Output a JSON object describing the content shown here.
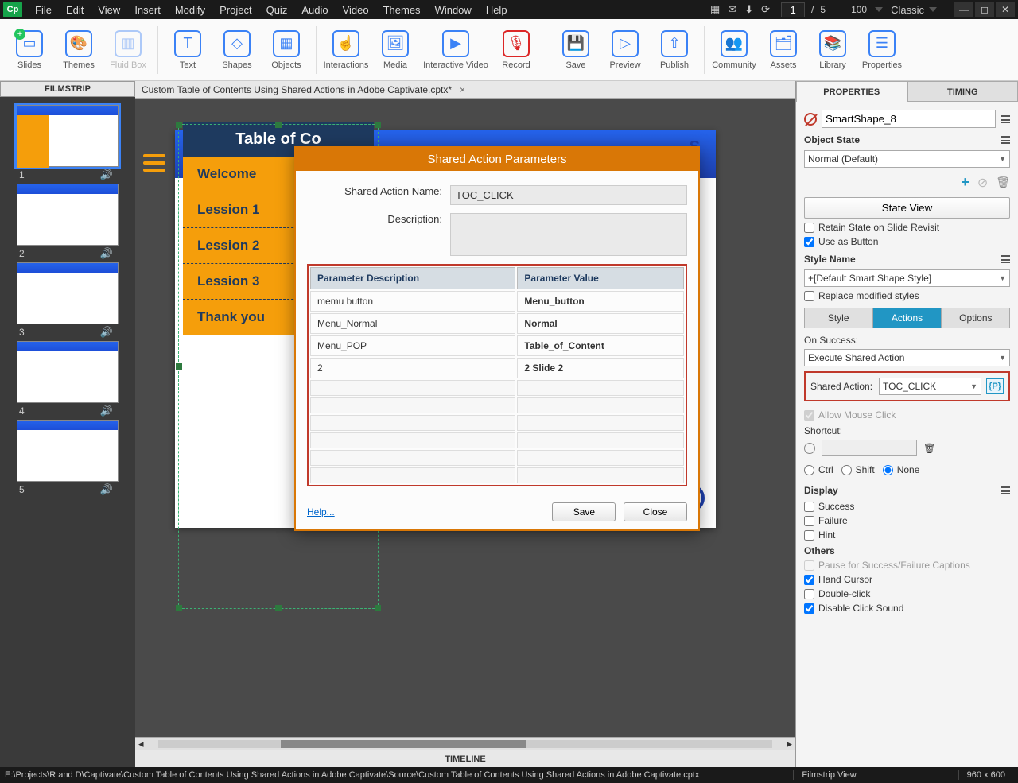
{
  "titlebar": {
    "workspace": "Classic"
  },
  "menu": [
    "File",
    "Edit",
    "View",
    "Insert",
    "Modify",
    "Project",
    "Quiz",
    "Audio",
    "Video",
    "Themes",
    "Window",
    "Help"
  ],
  "pager": {
    "current": "1",
    "total": "5",
    "zoom": "100"
  },
  "ribbon": [
    {
      "label": "Slides",
      "name": "slides"
    },
    {
      "label": "Themes",
      "name": "themes"
    },
    {
      "label": "Fluid Box",
      "name": "fluidbox",
      "disabled": true
    },
    {
      "label": "Text",
      "name": "text"
    },
    {
      "label": "Shapes",
      "name": "shapes"
    },
    {
      "label": "Objects",
      "name": "objects"
    },
    {
      "label": "Interactions",
      "name": "interactions"
    },
    {
      "label": "Media",
      "name": "media"
    },
    {
      "label": "Interactive Video",
      "name": "intvideo",
      "wide": true
    },
    {
      "label": "Record",
      "name": "record"
    },
    {
      "label": "Save",
      "name": "save"
    },
    {
      "label": "Preview",
      "name": "preview"
    },
    {
      "label": "Publish",
      "name": "publish"
    },
    {
      "label": "Community",
      "name": "community"
    },
    {
      "label": "Assets",
      "name": "assets"
    },
    {
      "label": "Library",
      "name": "library"
    },
    {
      "label": "Properties",
      "name": "properties"
    }
  ],
  "filmstrip": {
    "header": "FILMSTRIP",
    "slides": [
      "1",
      "2",
      "3",
      "4",
      "5"
    ]
  },
  "tab": {
    "title": "Custom Table of Contents Using Shared Actions in Adobe Captivate.cptx*"
  },
  "toc": {
    "title": "Table of Co",
    "items": [
      "Welcome",
      "Lession 1",
      "Lession 2",
      "Lession 3",
      "Thank you"
    ]
  },
  "dialog": {
    "title": "Shared Action Parameters",
    "nameLabel": "Shared Action Name:",
    "nameValue": "TOC_CLICK",
    "descLabel": "Description:",
    "cols": [
      "Parameter Description",
      "Parameter Value"
    ],
    "rows": [
      [
        "memu button",
        "Menu_button"
      ],
      [
        "Menu_Normal",
        "Normal"
      ],
      [
        "Menu_POP",
        "Table_of_Content"
      ],
      [
        "2",
        "2 Slide 2"
      ]
    ],
    "help": "Help...",
    "save": "Save",
    "close": "Close"
  },
  "props": {
    "tabs": [
      "PROPERTIES",
      "TIMING"
    ],
    "objectName": "SmartShape_8",
    "objectState": "Object State",
    "stateSelect": "Normal (Default)",
    "stateView": "State View",
    "retainState": "Retain State on Slide Revisit",
    "useAsButton": "Use as Button",
    "styleName": "Style Name",
    "styleSelect": "+[Default Smart Shape Style]",
    "replaceStyles": "Replace modified styles",
    "subtabs": [
      "Style",
      "Actions",
      "Options"
    ],
    "onSuccess": "On Success:",
    "onSuccessSelect": "Execute Shared Action",
    "sharedActionLabel": "Shared Action:",
    "sharedActionSelect": "TOC_CLICK",
    "allowClick": "Allow Mouse Click",
    "shortcut": "Shortcut:",
    "ctrl": "Ctrl",
    "shift": "Shift",
    "none": "None",
    "display": "Display",
    "success": "Success",
    "failure": "Failure",
    "hint": "Hint",
    "others": "Others",
    "pause": "Pause for Success/Failure Captions",
    "handCursor": "Hand Cursor",
    "doubleClick": "Double-click",
    "disableSound": "Disable Click Sound"
  },
  "timeline": "TIMELINE",
  "status": {
    "path": "E:\\Projects\\R and D\\Captivate\\Custom Table of Contents Using Shared Actions in Adobe Captivate\\Source\\Custom Table of Contents Using Shared Actions in Adobe Captivate.cptx",
    "view": "Filmstrip View",
    "dims": "960 x 600"
  }
}
